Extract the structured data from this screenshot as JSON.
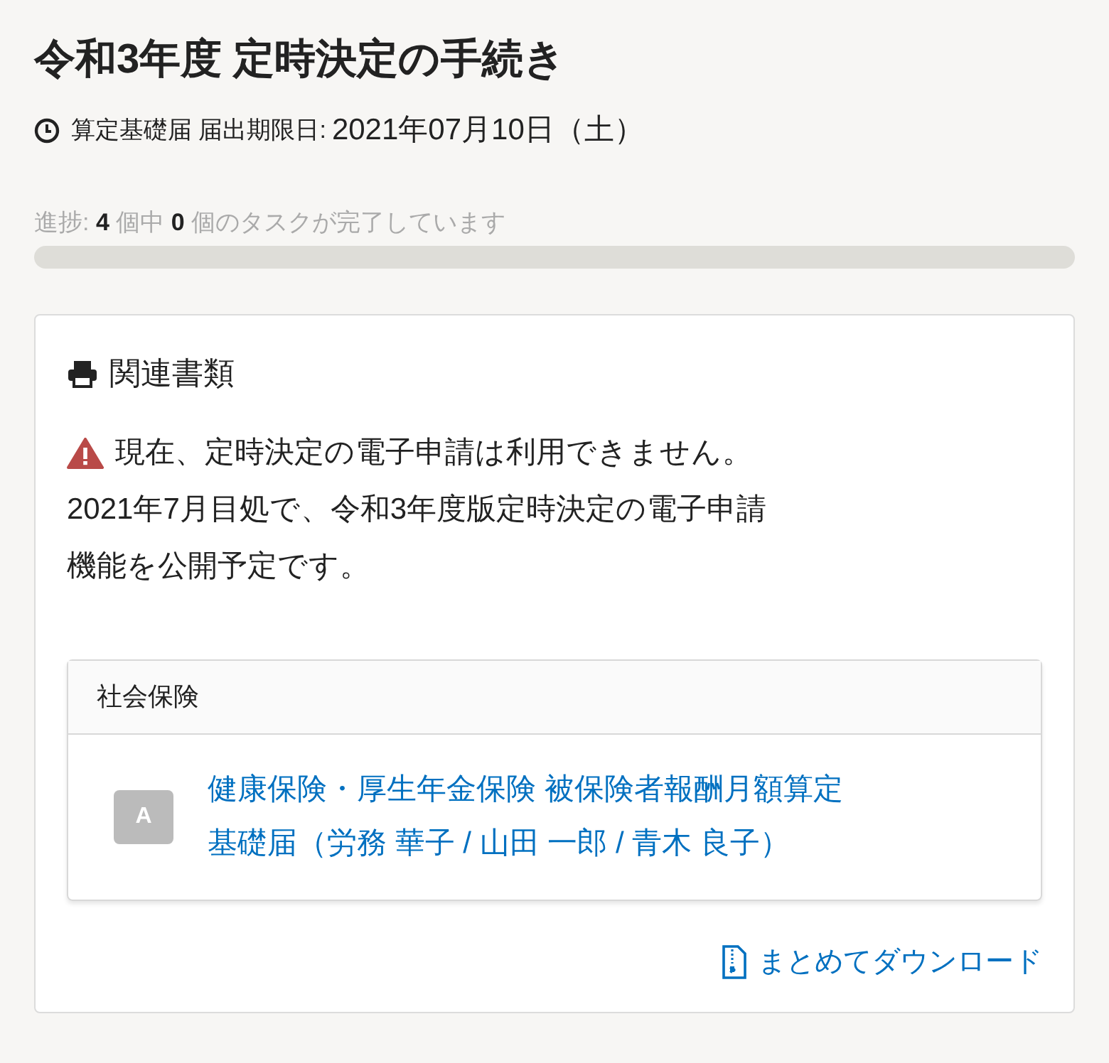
{
  "title": "令和3年度 定時決定の手続き",
  "deadline": {
    "label": "算定基礎届 届出期限日:",
    "date": "2021年07月10日（土）"
  },
  "progress": {
    "text": "進捗: **4** 個中 **0** 個のタスクが完了しています",
    "level": 0
  },
  "documents": {
    "heading": "関連書類",
    "notice": {
      "kind": "warning",
      "lines": [
        "現在、定時決定の電子申請は利用できません。",
        "2021年7月目処で、令和3年度版定時決定の電子申請",
        "機能を公開予定です。"
      ]
    },
    "groups": [
      {
        "title": "社会保険",
        "items": [
          {
            "badge": "A",
            "label_lines": [
              "健康保険・厚生年金保険 被保険者報酬月額算定",
              "基礎届（労務 華子 / 山田 一郎 / 青木 良子）"
            ]
          }
        ]
      }
    ],
    "download": "まとめてダウンロード"
  }
}
